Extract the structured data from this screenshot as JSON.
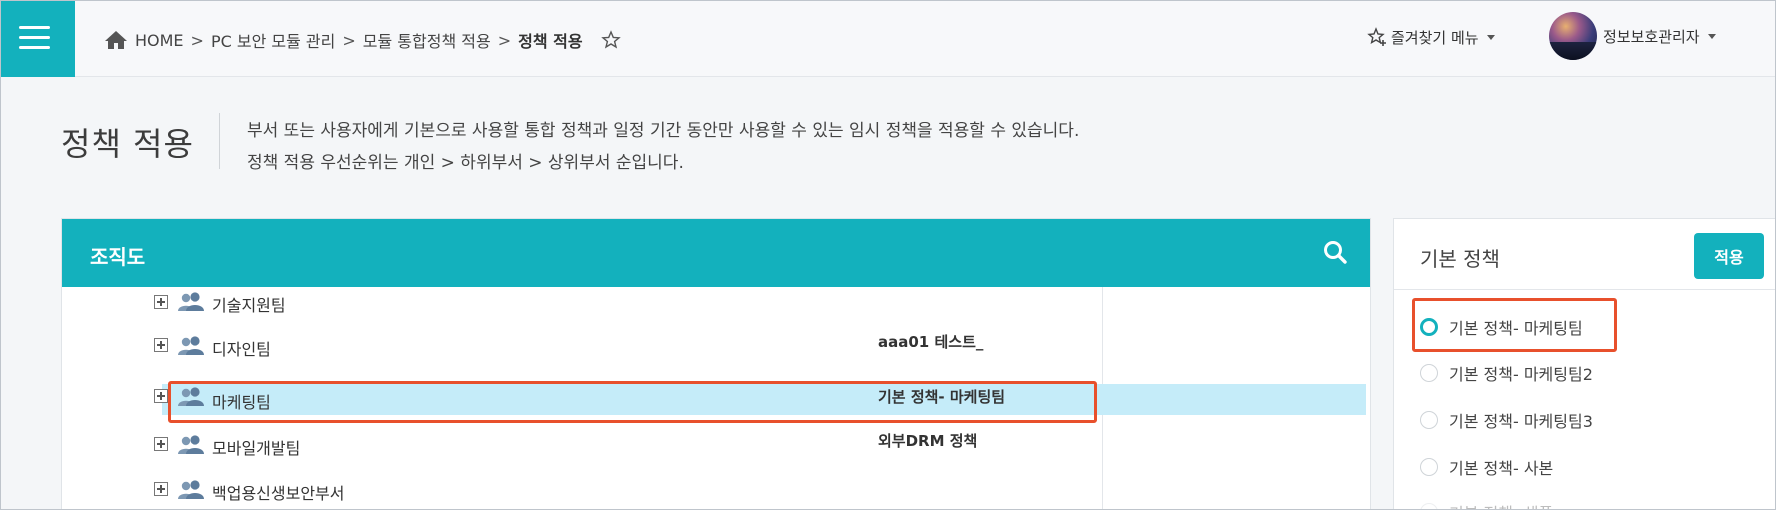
{
  "breadcrumb": {
    "home": "HOME",
    "sep": ">",
    "item1": "PC 보안 모듈 관리",
    "item2": "모듈 통합정책 적용",
    "current": "정책 적용"
  },
  "header": {
    "favorites": "즐겨찾기 메뉴",
    "user_name": "정보보호관리자"
  },
  "page": {
    "title": "정책 적용",
    "desc_line1": "부서 또는 사용자에게 기본으로 사용할 통합 정책과 일정 기간 동안만 사용할 수 있는 임시 정책을 적용할 수 있습니다.",
    "desc_line2": "정책 적용 우선순위는 개인 > 하위부서 > 상위부서 순입니다."
  },
  "org_panel": {
    "title": "조직도",
    "rows": [
      {
        "name": "기술지원팀",
        "policy": ""
      },
      {
        "name": "디자인팀",
        "policy": "aaa01 테스트_"
      },
      {
        "name": "마케팅팀",
        "policy": "기본 정책- 마케팅팀"
      },
      {
        "name": "모바일개발팀",
        "policy": "외부DRM 정책"
      },
      {
        "name": "백업용신생보안부서",
        "policy": ""
      }
    ]
  },
  "policy_panel": {
    "title": "기본 정책",
    "apply_label": "적용",
    "options": [
      {
        "label": "기본 정책- 마케팅팀",
        "checked": true
      },
      {
        "label": "기본 정책- 마케팅팀2",
        "checked": false
      },
      {
        "label": "기본 정책- 마케팅팀3",
        "checked": false
      },
      {
        "label": "기본 정책- 사본",
        "checked": false
      },
      {
        "label": "기본 정책- 샘플",
        "checked": false
      }
    ]
  },
  "colors": {
    "accent": "#13b1bd",
    "selection": "#c5ecf9",
    "highlight": "#e8502c"
  }
}
